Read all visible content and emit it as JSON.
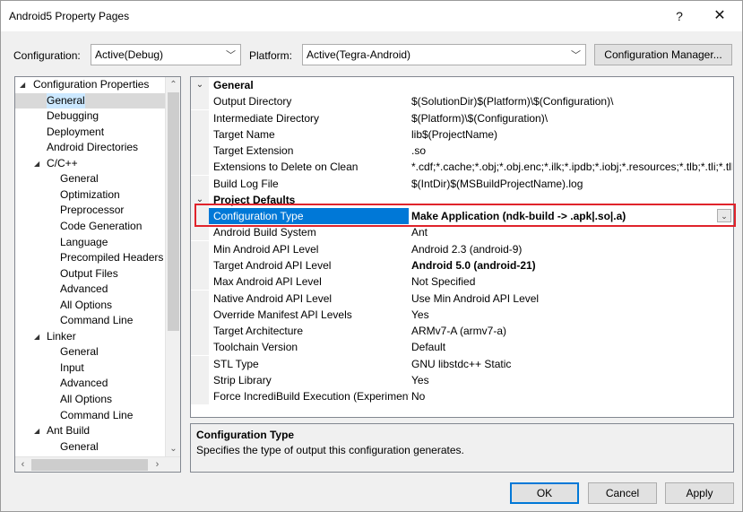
{
  "window": {
    "title": "Android5 Property Pages",
    "help_glyph": "?",
    "close_glyph": "✕"
  },
  "config_bar": {
    "configuration_label": "Configuration:",
    "configuration_value": "Active(Debug)",
    "platform_label": "Platform:",
    "platform_value": "Active(Tegra-Android)",
    "config_manager_label": "Configuration Manager..."
  },
  "tree": {
    "items": [
      {
        "label": "Configuration Properties",
        "level": 0,
        "expanded": true
      },
      {
        "label": "General",
        "level": 1,
        "selected": true
      },
      {
        "label": "Debugging",
        "level": 1
      },
      {
        "label": "Deployment",
        "level": 1
      },
      {
        "label": "Android Directories",
        "level": 1
      },
      {
        "label": "C/C++",
        "level": 1,
        "expanded": true
      },
      {
        "label": "General",
        "level": 2
      },
      {
        "label": "Optimization",
        "level": 2
      },
      {
        "label": "Preprocessor",
        "level": 2
      },
      {
        "label": "Code Generation",
        "level": 2
      },
      {
        "label": "Language",
        "level": 2
      },
      {
        "label": "Precompiled Headers",
        "level": 2
      },
      {
        "label": "Output Files",
        "level": 2
      },
      {
        "label": "Advanced",
        "level": 2
      },
      {
        "label": "All Options",
        "level": 2
      },
      {
        "label": "Command Line",
        "level": 2
      },
      {
        "label": "Linker",
        "level": 1,
        "expanded": true
      },
      {
        "label": "General",
        "level": 2
      },
      {
        "label": "Input",
        "level": 2
      },
      {
        "label": "Advanced",
        "level": 2
      },
      {
        "label": "All Options",
        "level": 2
      },
      {
        "label": "Command Line",
        "level": 2
      },
      {
        "label": "Ant Build",
        "level": 1,
        "expanded": true
      },
      {
        "label": "General",
        "level": 2
      }
    ]
  },
  "grid": {
    "rows": [
      {
        "category": true,
        "name": "General"
      },
      {
        "name": "Output Directory",
        "value": "$(SolutionDir)$(Platform)\\$(Configuration)\\"
      },
      {
        "name": "Intermediate Directory",
        "value": "$(Platform)\\$(Configuration)\\"
      },
      {
        "name": "Target Name",
        "value": "lib$(ProjectName)"
      },
      {
        "name": "Target Extension",
        "value": ".so"
      },
      {
        "name": "Extensions to Delete on Clean",
        "value": "*.cdf;*.cache;*.obj;*.obj.enc;*.ilk;*.ipdb;*.iobj;*.resources;*.tlb;*.tli;*.tlh;*"
      },
      {
        "name": "Build Log File",
        "value": "$(IntDir)$(MSBuildProjectName).log"
      },
      {
        "category": true,
        "name": "Project Defaults"
      },
      {
        "name": "Configuration Type",
        "value": "Make Application (ndk-build -> .apk|.so|.a)",
        "selected": true
      },
      {
        "name": "Android Build System",
        "value": "Ant"
      },
      {
        "name": "Min Android API Level",
        "value": "Android 2.3 (android-9)"
      },
      {
        "name": "Target Android API Level",
        "value": "Android 5.0 (android-21)",
        "bold": true
      },
      {
        "name": "Max Android API Level",
        "value": "Not Specified"
      },
      {
        "name": "Native Android API Level",
        "value": "Use Min Android API Level"
      },
      {
        "name": "Override Manifest API Levels",
        "value": "Yes"
      },
      {
        "name": "Target Architecture",
        "value": "ARMv7-A (armv7-a)"
      },
      {
        "name": "Toolchain Version",
        "value": "Default"
      },
      {
        "name": "STL Type",
        "value": "GNU libstdc++ Static"
      },
      {
        "name": "Strip Library",
        "value": "Yes"
      },
      {
        "name": "Force IncrediBuild Execution (Experiment",
        "value": "No"
      }
    ]
  },
  "description": {
    "title": "Configuration Type",
    "text": "Specifies the type of output this configuration generates."
  },
  "buttons": {
    "ok": "OK",
    "cancel": "Cancel",
    "apply": "Apply"
  }
}
